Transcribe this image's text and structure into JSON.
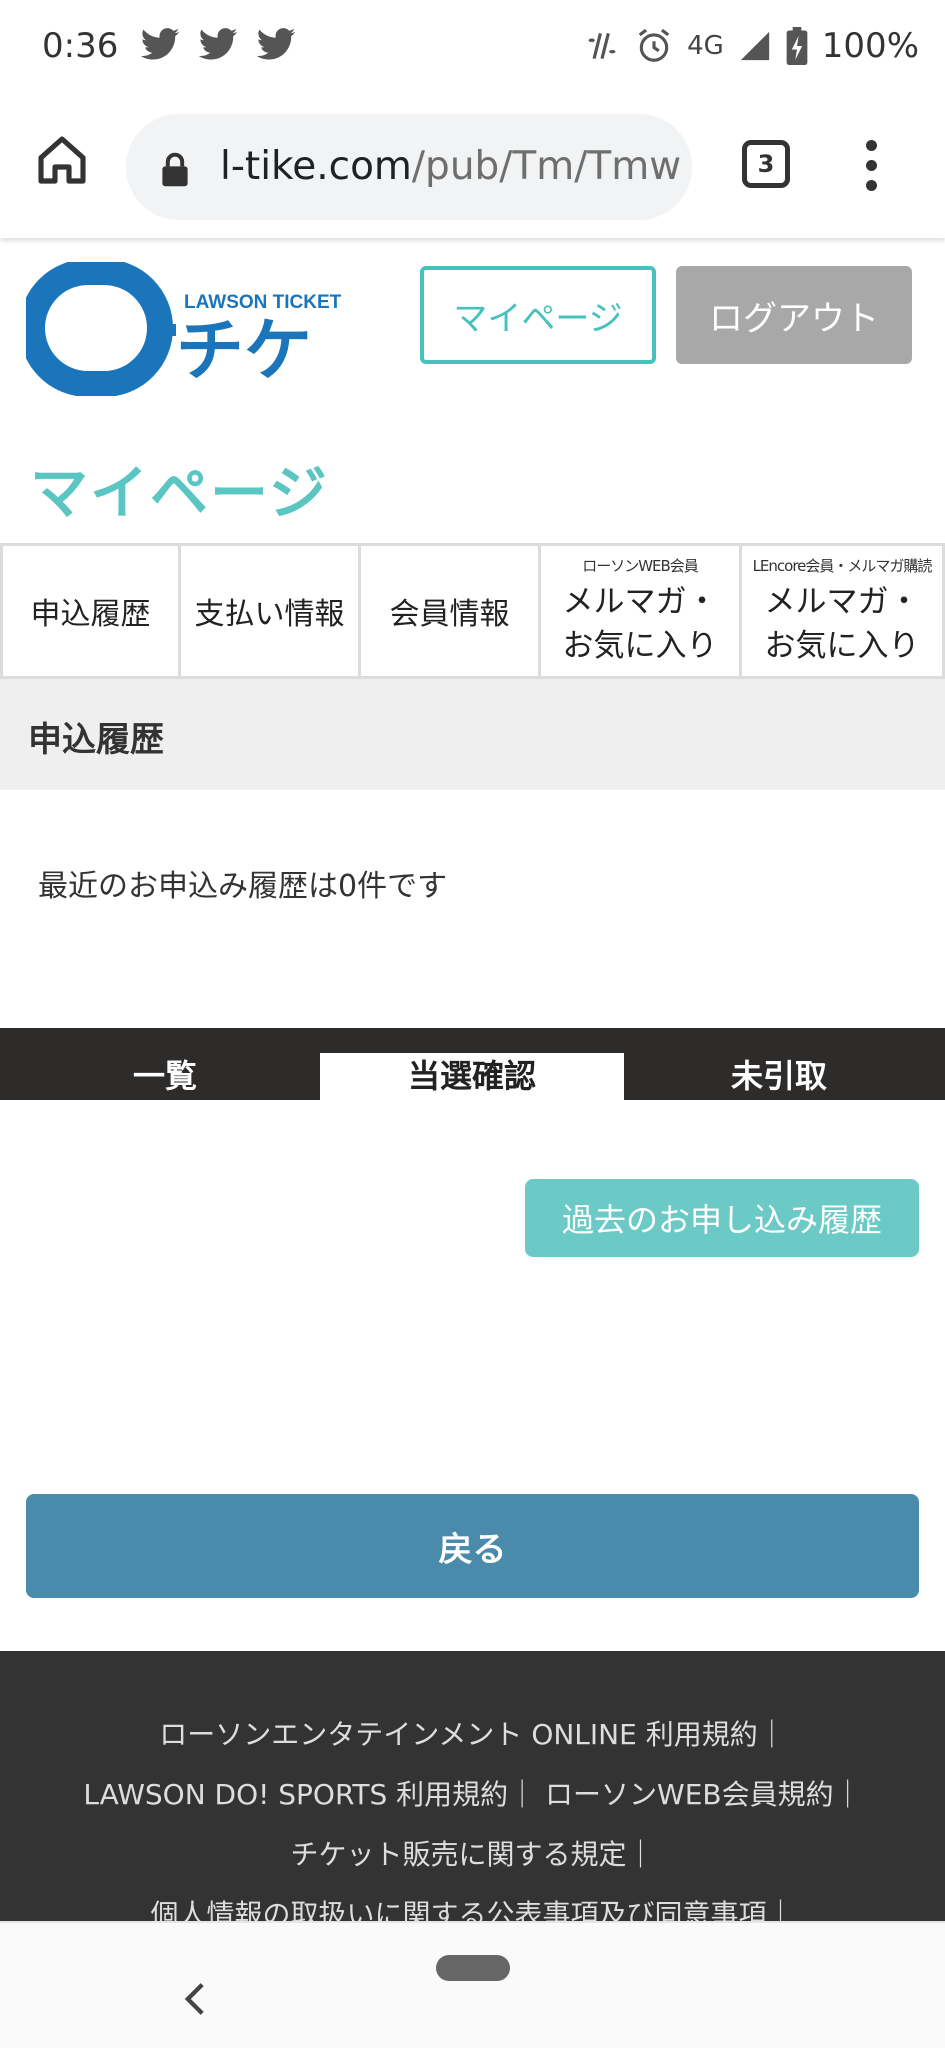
{
  "status_bar": {
    "time": "0:36",
    "notification_icons": [
      "twitter-icon",
      "twitter-icon",
      "twitter-icon"
    ],
    "network": "4G",
    "battery": "100%"
  },
  "browser": {
    "url_host": "l-tike.com",
    "url_path": "/pub/Tm/Tmw",
    "tab_count": "3"
  },
  "header": {
    "logo_text_small": "LAWSON TICKET",
    "logo_text_big": "チケ",
    "mypage_button": "マイページ",
    "logout_button": "ログアウト"
  },
  "page_title": "マイページ",
  "nav_tabs": [
    {
      "label": "申込履歴"
    },
    {
      "label": "支払い情報"
    },
    {
      "label": "会員情報"
    },
    {
      "small": "ローソンWEB会員",
      "line1": "メルマガ・",
      "line2": "お気に入り"
    },
    {
      "small": "LEncore会員・メルマガ購読",
      "line1": "メルマガ・",
      "line2": "お気に入り"
    }
  ],
  "section": {
    "heading": "申込履歴",
    "message": "最近のお申込み履歴は0件です"
  },
  "history_tabs": [
    {
      "label": "一覧",
      "active": false
    },
    {
      "label": "当選確認",
      "active": true
    },
    {
      "label": "未引取",
      "active": false
    }
  ],
  "past_history_button": "過去のお申し込み履歴",
  "back_button": "戻る",
  "footer": {
    "lines": [
      "ローソンエンタテインメント ONLINE 利用規約｜",
      "LAWSON DO! SPORTS 利用規約｜ ローソンWEB会員規約｜",
      "チケット販売に関する規定｜",
      "個人情報の取扱いに関する公表事項及び同意事項｜"
    ]
  },
  "colors": {
    "accent_teal": "#46c1bd",
    "back_button_blue": "#4a8aab",
    "logo_blue": "#1a75bb"
  }
}
